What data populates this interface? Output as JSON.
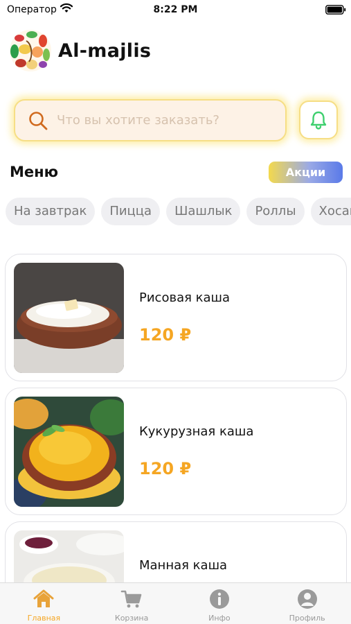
{
  "status_bar": {
    "carrier": "Оператор",
    "time": "8:22 PM"
  },
  "app": {
    "title": "Al-majlis"
  },
  "search": {
    "placeholder": "Что вы хотите заказать?"
  },
  "menu": {
    "title": "Меню",
    "promo_label": "Акции"
  },
  "categories": [
    "На завтрак",
    "Пицца",
    "Шашлык",
    "Роллы",
    "Хосаг"
  ],
  "products": [
    {
      "name": "Рисовая каша",
      "price": "120 ₽"
    },
    {
      "name": "Кукурузная каша",
      "price": "120 ₽"
    },
    {
      "name": "Манная каша",
      "price": ""
    }
  ],
  "tab_bar": {
    "tabs": [
      {
        "label": "Главная",
        "icon": "home-icon",
        "active": true
      },
      {
        "label": "Корзина",
        "icon": "cart-icon",
        "active": false
      },
      {
        "label": "Инфо",
        "icon": "info-icon",
        "active": false
      },
      {
        "label": "Профиль",
        "icon": "profile-icon",
        "active": false
      }
    ]
  },
  "colors": {
    "accent": "#f5a623",
    "chip_bg": "#efeff2",
    "search_bg": "#fdf2e6",
    "bell": "#3ecf6e"
  }
}
